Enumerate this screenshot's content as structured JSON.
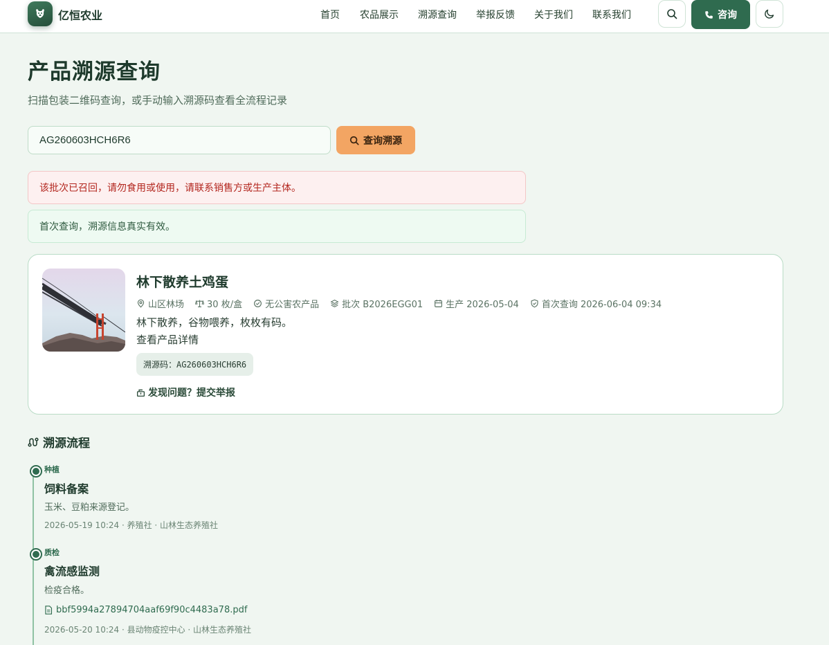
{
  "header": {
    "brand": "亿恒农业",
    "nav": [
      "首页",
      "农品展示",
      "溯源查询",
      "举报反馈",
      "关于我们",
      "联系我们"
    ],
    "consult_label": "咨询"
  },
  "page": {
    "title": "产品溯源查询",
    "subtitle": "扫描包装二维码查询，或手动输入溯源码查看全流程记录"
  },
  "search": {
    "value": "AG260603HCH6R6",
    "button_label": "查询溯源"
  },
  "alerts": {
    "recall": "该批次已召回，请勿食用或使用，请联系销售方或生产主体。",
    "first_query": "首次查询，溯源信息真实有效。"
  },
  "product": {
    "name": "林下散养土鸡蛋",
    "meta": {
      "origin": "山区林场",
      "spec": "30 枚/盒",
      "cert": "无公害农产品",
      "batch": "批次 B2026EGG01",
      "produced": "生产 2026-05-04",
      "first_query": "首次查询 2026-06-04 09:34"
    },
    "description": "林下散养，谷物喂养，枚枚有码。",
    "detail_link": "查看产品详情",
    "trace_code_label": "溯源码：AG260603HCH6R6",
    "report_link": "发现问题？提交举报"
  },
  "flow": {
    "title": "溯源流程",
    "steps": [
      {
        "tag": "种植",
        "title": "饲料备案",
        "desc": "玉米、豆粕来源登记。",
        "meta": "2026-05-19 10:24 · 养殖社 · 山林生态养殖社"
      },
      {
        "tag": "质检",
        "title": "禽流感监测",
        "desc": "检疫合格。",
        "file": "bbf5994a27894704aaf69f90c4483a78.pdf",
        "meta": "2026-05-20 10:24 · 县动物疫控中心 · 山林生态养殖社"
      }
    ]
  },
  "colors": {
    "primary": "#2f6b4f",
    "accent": "#f3a563",
    "background": "#f0f6f1",
    "danger": "#b3261e"
  },
  "icons": [
    "logo-icon",
    "search-icon",
    "phone-icon",
    "moon-icon",
    "location-icon",
    "scale-icon",
    "check-circle-icon",
    "layers-icon",
    "calendar-icon",
    "shield-check-icon",
    "report-icon",
    "route-icon",
    "file-icon"
  ]
}
